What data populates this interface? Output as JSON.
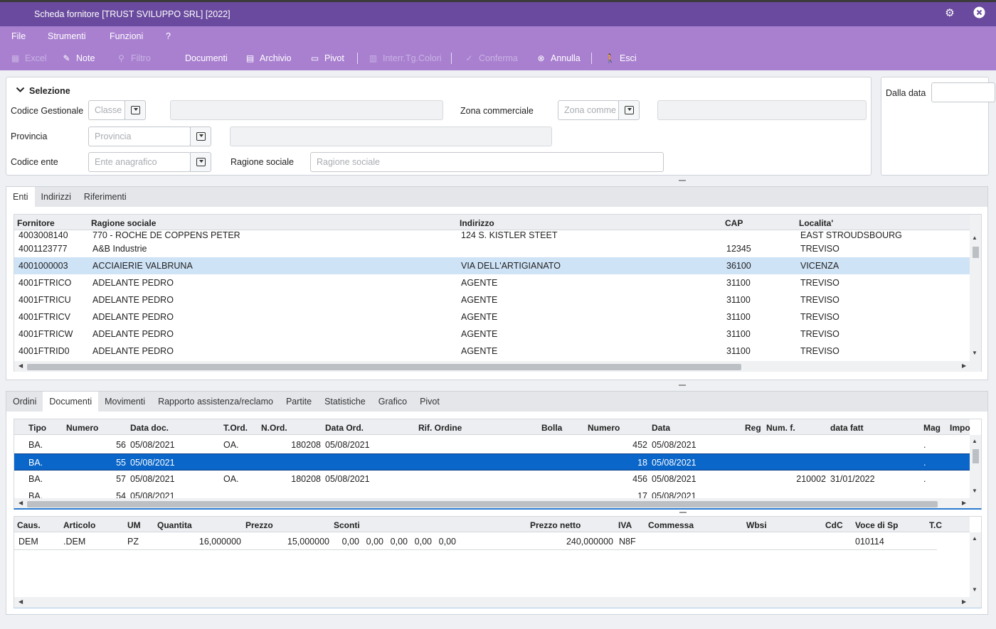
{
  "window": {
    "title": "Scheda fornitore [TRUST SVILUPPO SRL] [2022]"
  },
  "menu": [
    "File",
    "Strumenti",
    "Funzioni",
    "?"
  ],
  "toolbar": {
    "excel": "Excel",
    "note": "Note",
    "filtro": "Filtro",
    "documenti": "Documenti",
    "archivio": "Archivio",
    "pivot": "Pivot",
    "interr": "Interr.Tg.Colori",
    "conferma": "Conferma",
    "annulla": "Annulla",
    "esci": "Esci"
  },
  "selezione": {
    "title": "Selezione",
    "codice_gestionale_label": "Codice Gestionale",
    "classe_placeholder": "Classe",
    "zona_label": "Zona commerciale",
    "zona_placeholder": "Zona comme",
    "provincia_label": "Provincia",
    "provincia_placeholder": "Provincia",
    "codice_ente_label": "Codice ente",
    "ente_placeholder": "Ente anagrafico",
    "ragione_label": "Ragione sociale",
    "ragione_placeholder": "Ragione sociale",
    "dalla_data_label": "Dalla data"
  },
  "top_tabs": [
    "Enti",
    "Indirizzi",
    "Riferimenti"
  ],
  "enti_grid": {
    "headers": [
      "Fornitore",
      "Ragione sociale",
      "Indirizzo",
      "CAP",
      "Localita'"
    ],
    "rows": [
      [
        "4003008140",
        "770 - ROCHE DE COPPENS PETER",
        "124 S. KISTLER STEET",
        "",
        "EAST STROUDSBOURG"
      ],
      [
        "4001123777",
        "A&B Industrie",
        "",
        "12345",
        "TREVISO"
      ],
      [
        "4001000003",
        "ACCIAIERIE VALBRUNA",
        "VIA DELL'ARTIGIANATO",
        "36100",
        "VICENZA"
      ],
      [
        "4001FTRICO",
        "ADELANTE PEDRO",
        "AGENTE",
        "31100",
        "TREVISO"
      ],
      [
        "4001FTRICU",
        "ADELANTE PEDRO",
        "AGENTE",
        "31100",
        "TREVISO"
      ],
      [
        "4001FTRICV",
        "ADELANTE PEDRO",
        "AGENTE",
        "31100",
        "TREVISO"
      ],
      [
        "4001FTRICW",
        "ADELANTE PEDRO",
        "AGENTE",
        "31100",
        "TREVISO"
      ],
      [
        "4001FTRID0",
        "ADELANTE PEDRO",
        "AGENTE",
        "31100",
        "TREVISO"
      ]
    ],
    "selected_row": 2
  },
  "bottom_tabs": [
    "Ordini",
    "Documenti",
    "Movimenti",
    "Rapporto assistenza/reclamo",
    "Partite",
    "Statistiche",
    "Grafico",
    "Pivot"
  ],
  "doc_grid": {
    "headers": [
      "Tipo",
      "Numero",
      "Data doc.",
      "T.Ord.",
      "N.Ord.",
      "Data Ord.",
      "Rif. Ordine",
      "Bolla",
      "Numero",
      "Data",
      "Reg",
      "Num. f.",
      "data fatt",
      "Mag",
      "Impo"
    ],
    "rows": [
      [
        "BA.",
        "56",
        "05/08/2021",
        "OA.",
        "180208",
        "05/08/2021",
        "",
        "",
        "452",
        "05/08/2021",
        "",
        "",
        "",
        "."
      ],
      [
        "BA.",
        "55",
        "05/08/2021",
        "",
        "",
        "",
        "",
        "",
        "18",
        "05/08/2021",
        "",
        "",
        "",
        "."
      ],
      [
        "BA.",
        "57",
        "05/08/2021",
        "OA.",
        "180208",
        "05/08/2021",
        "",
        "",
        "456",
        "05/08/2021",
        "",
        "210002",
        "31/01/2022",
        "."
      ],
      [
        "BA.",
        "54",
        "05/08/2021",
        "",
        "",
        "",
        "",
        "",
        "17",
        "05/08/2021",
        "",
        "",
        "",
        ""
      ]
    ],
    "selected_row": 1
  },
  "detail_grid": {
    "headers": [
      "Caus.",
      "Articolo",
      "UM",
      "Quantita",
      "Prezzo",
      "Sconti",
      "Prezzo netto",
      "IVA",
      "Commessa",
      "Wbsi",
      "CdC",
      "Voce di Sp",
      "T.C"
    ],
    "rows": [
      [
        "DEM",
        ".DEM",
        "PZ",
        "16,000000",
        "15,000000",
        "0,00",
        "0,00",
        "0,00",
        "0,00",
        "0,00",
        "240,000000",
        "N8F",
        "",
        "",
        "",
        "010114"
      ]
    ]
  }
}
